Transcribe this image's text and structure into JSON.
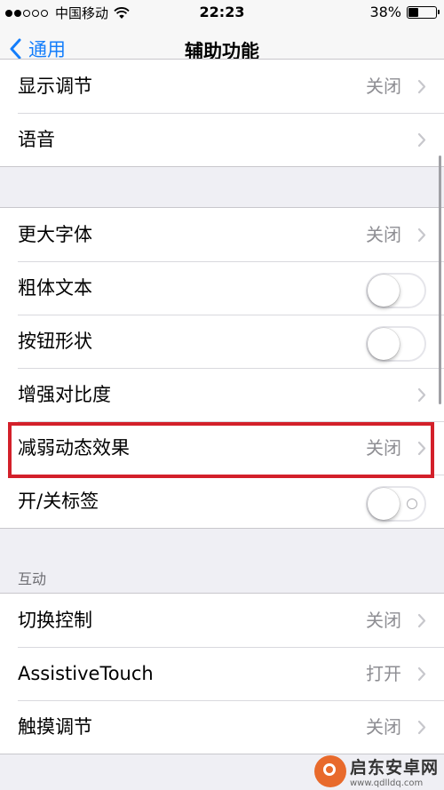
{
  "status_bar": {
    "carrier": "中国移动",
    "time": "22:23",
    "battery_percent": "38%",
    "battery_level": 0.38,
    "signal_dots_filled": 2,
    "signal_dots_total": 5
  },
  "nav": {
    "back_label": "通用",
    "title": "辅助功能"
  },
  "group1": [
    {
      "label": "显示调节",
      "value": "关闭",
      "accessory": "chevron"
    },
    {
      "label": "语音",
      "value": "",
      "accessory": "chevron"
    }
  ],
  "group2": [
    {
      "label": "更大字体",
      "value": "关闭",
      "accessory": "chevron"
    },
    {
      "label": "粗体文本",
      "accessory": "toggle",
      "on": false
    },
    {
      "label": "按钮形状",
      "accessory": "toggle",
      "on": false
    },
    {
      "label": "增强对比度",
      "value": "",
      "accessory": "chevron"
    },
    {
      "label": "减弱动态效果",
      "value": "关闭",
      "accessory": "chevron",
      "highlighted": true
    },
    {
      "label": "开/关标签",
      "accessory": "toggle",
      "on": false
    }
  ],
  "section_header": "互动",
  "group3": [
    {
      "label": "切换控制",
      "value": "关闭",
      "accessory": "chevron"
    },
    {
      "label": "AssistiveTouch",
      "value": "打开",
      "accessory": "chevron"
    },
    {
      "label": "触摸调节",
      "value": "关闭",
      "accessory": "chevron"
    }
  ],
  "watermark": {
    "name": "启东安卓网",
    "url": "www.qdlldq.com"
  },
  "colors": {
    "accent": "#147efb",
    "highlight_border": "#d3202a",
    "background": "#efeff4"
  }
}
